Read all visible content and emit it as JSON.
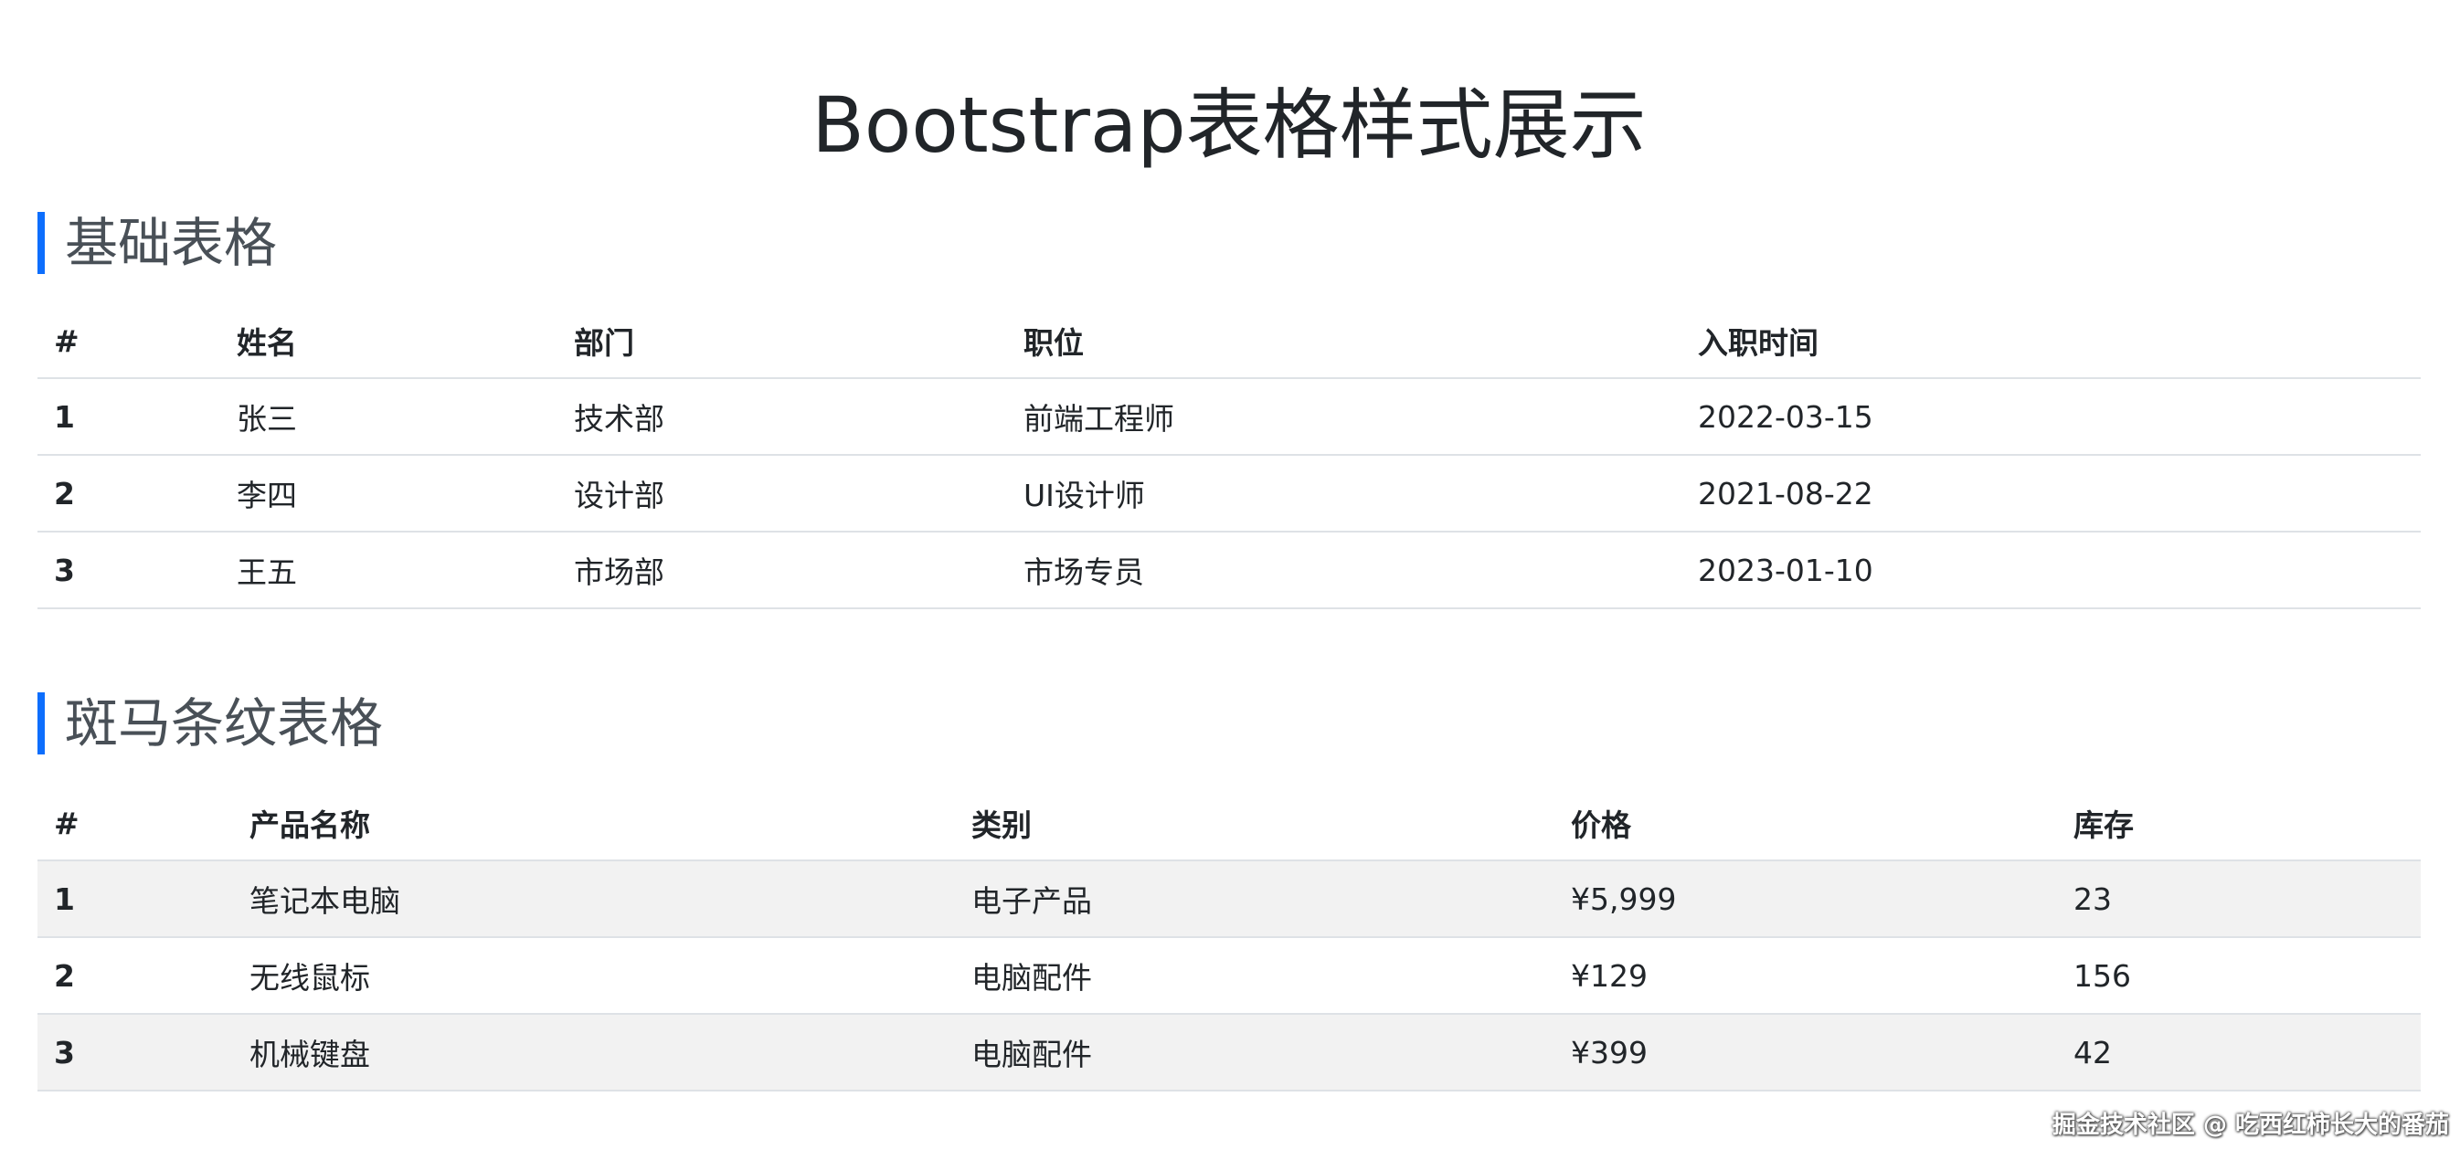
{
  "page": {
    "title": "Bootstrap表格样式展示"
  },
  "basic_table": {
    "heading": "基础表格",
    "columns": [
      "#",
      "姓名",
      "部门",
      "职位",
      "入职时间"
    ],
    "rows": [
      [
        "1",
        "张三",
        "技术部",
        "前端工程师",
        "2022-03-15"
      ],
      [
        "2",
        "李四",
        "设计部",
        "UI设计师",
        "2021-08-22"
      ],
      [
        "3",
        "王五",
        "市场部",
        "市场专员",
        "2023-01-10"
      ]
    ]
  },
  "striped_table": {
    "heading": "斑马条纹表格",
    "columns": [
      "#",
      "产品名称",
      "类别",
      "价格",
      "库存"
    ],
    "rows": [
      [
        "1",
        "笔记本电脑",
        "电子产品",
        "¥5,999",
        "23"
      ],
      [
        "2",
        "无线鼠标",
        "电脑配件",
        "¥129",
        "156"
      ],
      [
        "3",
        "机械键盘",
        "电脑配件",
        "¥399",
        "42"
      ]
    ]
  },
  "watermark": {
    "text": "掘金技术社区 @ 吃西红柿长大的番茄"
  },
  "colors": {
    "accent": "#0d6efd",
    "stripe": "#f2f2f2",
    "border": "#dee2e6",
    "text": "#212529",
    "heading": "#495057"
  }
}
